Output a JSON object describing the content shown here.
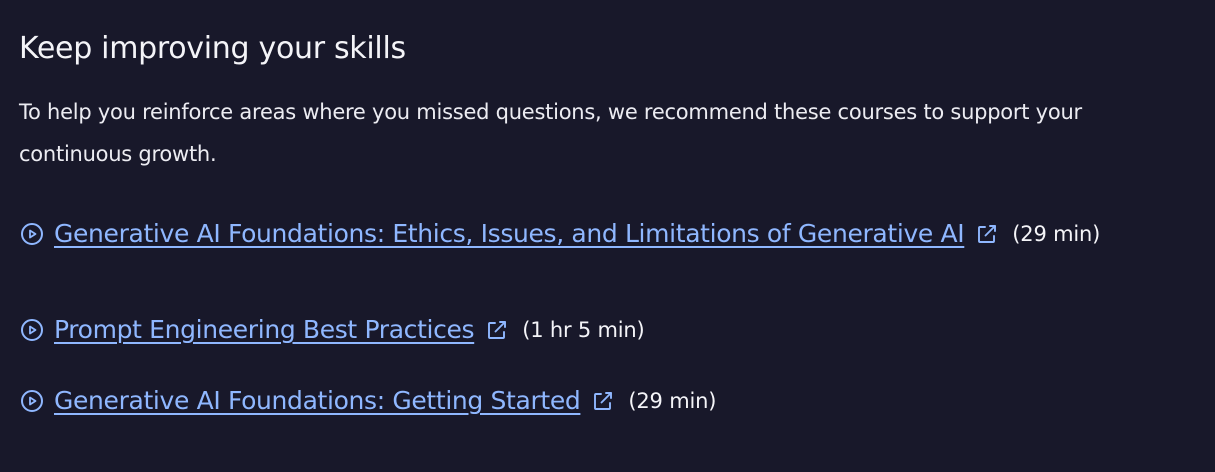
{
  "section": {
    "title": "Keep improving your skills",
    "description": "To help you reinforce areas where you missed questions, we recommend these courses to support your continuous growth."
  },
  "courses": [
    {
      "title": "Generative AI Foundations: Ethics, Issues, and Limitations of Generative AI",
      "duration": "(29 min)",
      "lead_icon": "play-circle-icon",
      "link_icon": "external-link-icon"
    },
    {
      "title": "Prompt Engineering Best Practices",
      "duration": "(1 hr 5 min)",
      "lead_icon": "play-circle-icon",
      "link_icon": "external-link-icon"
    },
    {
      "title": "Generative AI Foundations: Getting Started",
      "duration": "(29 min)",
      "lead_icon": "play-circle-icon",
      "link_icon": "external-link-icon"
    }
  ],
  "colors": {
    "background": "#18182a",
    "text": "#f2f2f6",
    "link": "#8fb7ff"
  }
}
